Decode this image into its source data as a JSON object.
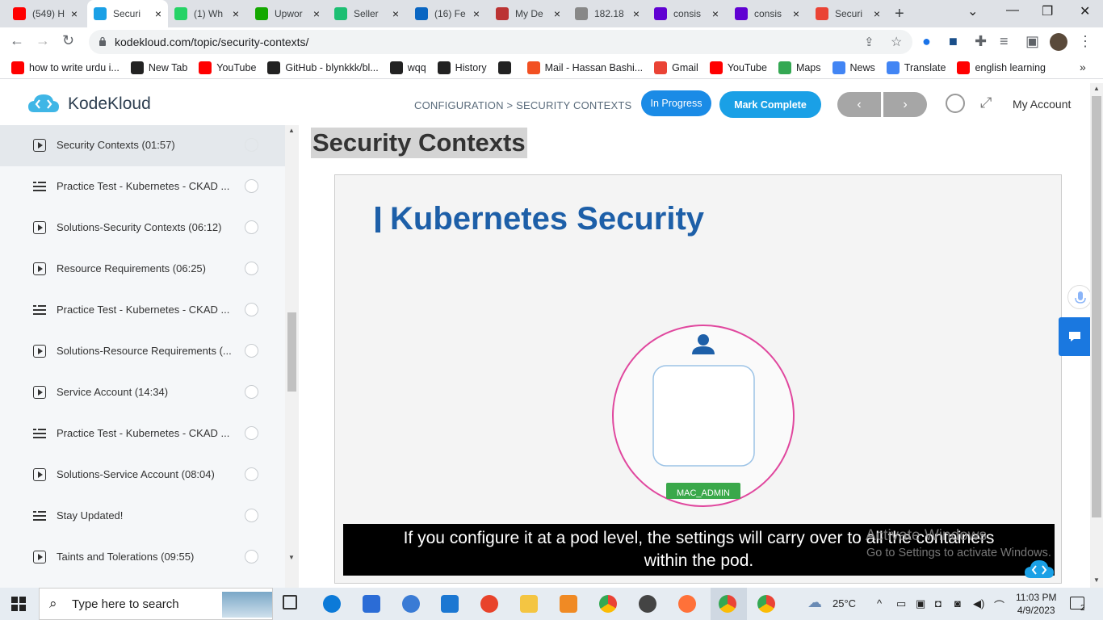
{
  "browser": {
    "tabs": [
      {
        "label": "(549) H",
        "icon": "youtube-icon",
        "color": "#ff0000"
      },
      {
        "label": "Securi",
        "icon": "kodekloud-icon",
        "color": "#1aa0e6",
        "active": true
      },
      {
        "label": "(1) Wh",
        "icon": "whatsapp-icon",
        "color": "#25d366"
      },
      {
        "label": "Upwor",
        "icon": "upwork-icon",
        "color": "#14a800"
      },
      {
        "label": "Seller",
        "icon": "fiverr-icon",
        "color": "#1dbf73"
      },
      {
        "label": "(16) Fe",
        "icon": "linkedin-icon",
        "color": "#0a66c2"
      },
      {
        "label": "My De",
        "icon": "mydesk-icon",
        "color": "#b33"
      },
      {
        "label": "182.18",
        "icon": "globe-icon",
        "color": "#888"
      },
      {
        "label": "consis",
        "icon": "yahoo-icon",
        "color": "#6001d2"
      },
      {
        "label": "consis",
        "icon": "yahoo-icon",
        "color": "#6001d2"
      },
      {
        "label": "Securi",
        "icon": "gmail-icon",
        "color": "#ea4335"
      }
    ],
    "url": "kodekloud.com/topic/security-contexts/",
    "bookmarks": [
      {
        "label": "how to write urdu i...",
        "icon": "youtube-icon",
        "color": "#ff0000"
      },
      {
        "label": "New Tab",
        "icon": "globe-icon",
        "color": "#222"
      },
      {
        "label": "YouTube",
        "icon": "youtube-icon",
        "color": "#ff0000"
      },
      {
        "label": "GitHub - blynkkk/bl...",
        "icon": "github-icon",
        "color": "#222"
      },
      {
        "label": "wqq",
        "icon": "download-icon",
        "color": "#222"
      },
      {
        "label": "History",
        "icon": "history-icon",
        "color": "#222"
      },
      {
        "label": "",
        "icon": "globe-icon",
        "color": "#222"
      },
      {
        "label": "Mail - Hassan Bashi...",
        "icon": "microsoft-icon",
        "color": "#f25022"
      },
      {
        "label": "Gmail",
        "icon": "gmail-icon",
        "color": "#ea4335"
      },
      {
        "label": "YouTube",
        "icon": "youtube-icon",
        "color": "#ff0000"
      },
      {
        "label": "Maps",
        "icon": "maps-icon",
        "color": "#34a853"
      },
      {
        "label": "News",
        "icon": "news-icon",
        "color": "#4285f4"
      },
      {
        "label": "Translate",
        "icon": "translate-icon",
        "color": "#4285f4"
      },
      {
        "label": "english learning",
        "icon": "youtube-icon",
        "color": "#ff0000"
      }
    ],
    "more_bookmarks": "»"
  },
  "header": {
    "brand": "KodeKloud",
    "breadcrumb": "CONFIGURATION > SECURITY CONTEXTS",
    "status_button": "In Progress",
    "mark_complete": "Mark Complete",
    "prev": "‹",
    "next": "›",
    "account": "My Account"
  },
  "sidebar": {
    "items": [
      {
        "label": "Security Contexts (01:57)",
        "type": "video",
        "active": true
      },
      {
        "label": "Practice Test - Kubernetes - CKAD ...",
        "type": "lab"
      },
      {
        "label": "Solutions-Security Contexts (06:12)",
        "type": "video"
      },
      {
        "label": "Resource Requirements (06:25)",
        "type": "video"
      },
      {
        "label": "Practice Test - Kubernetes - CKAD ...",
        "type": "lab"
      },
      {
        "label": "Solutions-Resource Requirements (...",
        "type": "video"
      },
      {
        "label": "Service Account (14:34)",
        "type": "video"
      },
      {
        "label": "Practice Test - Kubernetes - CKAD ...",
        "type": "lab"
      },
      {
        "label": "Solutions-Service Account (08:04)",
        "type": "video"
      },
      {
        "label": "Stay Updated!",
        "type": "lab"
      },
      {
        "label": "Taints and Tolerations (09:55)",
        "type": "video"
      }
    ]
  },
  "content": {
    "title": "Security Contexts",
    "video": {
      "slide_title": "Kubernetes Security",
      "user_label": "MAC_ADMIN",
      "caption_line1": "If you configure it at a pod level, the settings will carry over to all the containers",
      "caption_line2": "within the pod."
    },
    "watermark_line1": "Activate Windows",
    "watermark_line2": "Go to Settings to activate Windows."
  },
  "taskbar": {
    "search_placeholder": "Type here to search",
    "weather": "25°C",
    "time": "11:03 PM",
    "date": "4/9/2023",
    "notifications": "2"
  },
  "colors": {
    "accent": "#1aa0e6",
    "slide_blue": "#1d5fa8",
    "pod_circle": "#e0479e",
    "user_badge": "#3aa84a"
  }
}
